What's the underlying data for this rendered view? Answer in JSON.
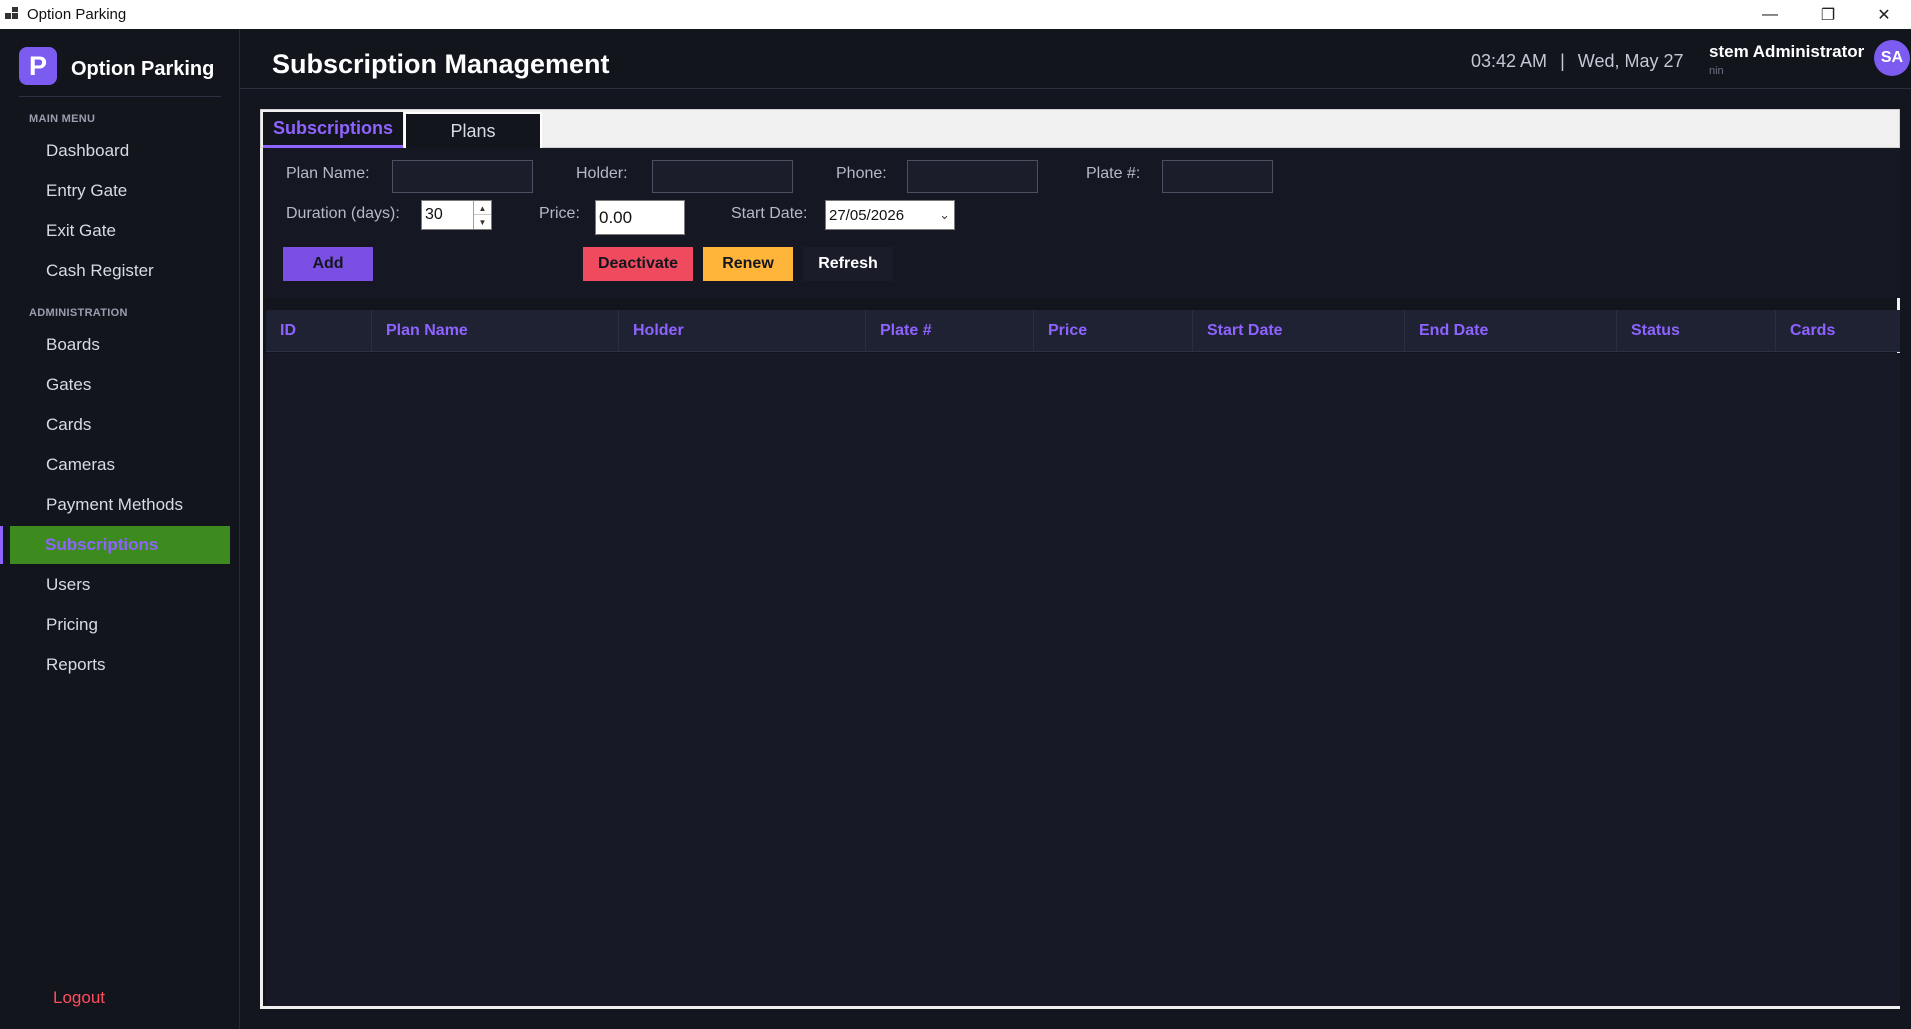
{
  "window": {
    "title": "Option Parking",
    "minimize_glyph": "—",
    "restore_glyph": "❐",
    "close_glyph": "✕"
  },
  "brand": {
    "logo_letter": "P",
    "name": "Option Parking"
  },
  "sidebar": {
    "main_menu_label": "MAIN MENU",
    "main_items": [
      {
        "label": "Dashboard"
      },
      {
        "label": "Entry Gate"
      },
      {
        "label": "Exit Gate"
      },
      {
        "label": "Cash Register"
      }
    ],
    "admin_label": "ADMINISTRATION",
    "admin_items": [
      {
        "label": "Boards"
      },
      {
        "label": "Gates"
      },
      {
        "label": "Cards"
      },
      {
        "label": "Cameras"
      },
      {
        "label": "Payment Methods"
      },
      {
        "label": "Subscriptions",
        "active": true
      },
      {
        "label": "Users"
      },
      {
        "label": "Pricing"
      },
      {
        "label": "Reports"
      }
    ],
    "logout_label": "Logout"
  },
  "header": {
    "title": "Subscription Management",
    "time": "03:42 AM",
    "separator": "|",
    "date": "Wed, May 27",
    "user_name": "stem Administrator",
    "user_role": "nin",
    "avatar_initials": "SA"
  },
  "tabs": [
    {
      "label": "Subscriptions",
      "active": true
    },
    {
      "label": "Plans",
      "active": false
    }
  ],
  "form": {
    "plan_name_label": "Plan Name:",
    "plan_name_value": "",
    "holder_label": "Holder:",
    "holder_value": "",
    "phone_label": "Phone:",
    "phone_value": "",
    "plate_label": "Plate #:",
    "plate_value": "",
    "duration_label": "Duration (days):",
    "duration_value": "30",
    "price_label": "Price:",
    "price_value": "0.00",
    "start_date_label": "Start Date:",
    "start_date_value": "27/05/2026"
  },
  "buttons": {
    "add": "Add",
    "deactivate": "Deactivate",
    "renew": "Renew",
    "refresh": "Refresh"
  },
  "colors": {
    "accent": "#8f63ff",
    "add_button": "#7b4fe3",
    "deactivate_button": "#f04a5e",
    "renew_button": "#ffb53a",
    "active_nav_bg": "#3d8a1f",
    "logout": "#ff4d5f"
  },
  "table": {
    "columns": [
      "ID",
      "Plan Name",
      "Holder",
      "Plate #",
      "Price",
      "Start Date",
      "End Date",
      "Status",
      "Cards"
    ],
    "rows": []
  }
}
